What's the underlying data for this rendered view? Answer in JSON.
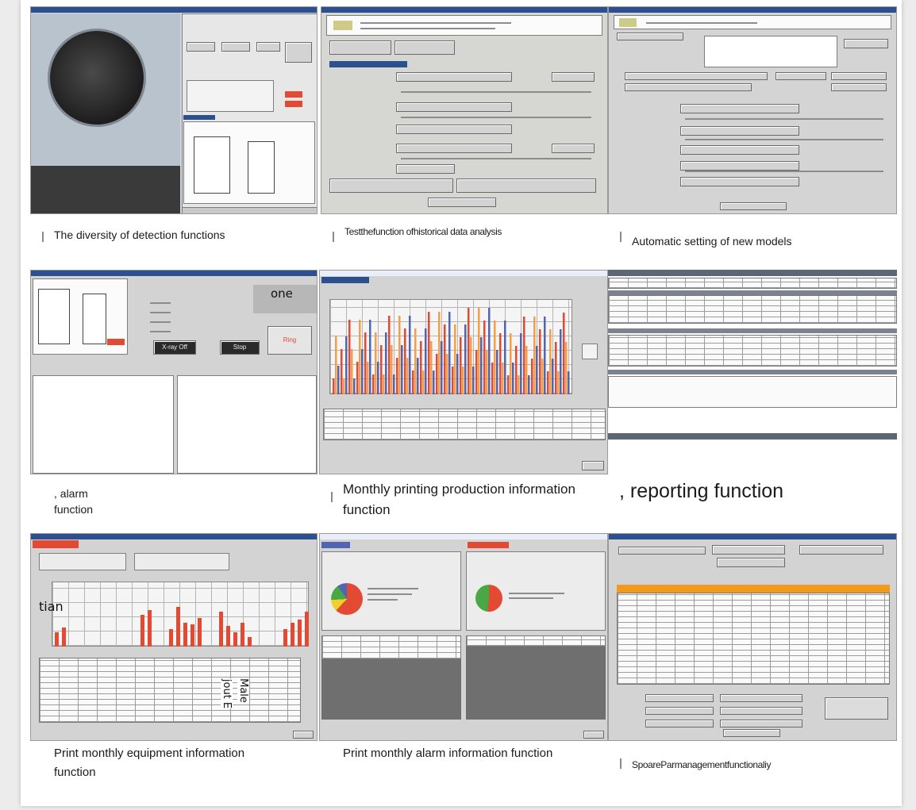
{
  "captions": {
    "c1": "The diversity of detection functions",
    "c2": "Testthefunction ofhistorical data analysis",
    "c3": "Automatic setting of new models",
    "c4": ", alarm function",
    "c5": "Monthly printing production information function",
    "c6": ", reporting function",
    "c7": "Print monthly equipment information function",
    "c8": "Print monthly alarm information function",
    "c9": "SpoareParmanagementfunctionaliy"
  },
  "overlays": {
    "one": "one",
    "stop_off_btn": "X-ray Off",
    "stop_btn": "Stop",
    "ring_btn": "Ring",
    "tian": "tian",
    "male": "Male",
    "jout_e": "jout E"
  },
  "colors": {
    "title_bar": "#2c4f90",
    "window_gray": "#d7d7d7",
    "bar_red": "#e34a33",
    "bar_orange": "#f0a04b",
    "bar_blue": "#5066b4",
    "table_header_orange": "#f29a1b",
    "pie_green": "#48a843",
    "pie_yellow": "#f2cf2c"
  }
}
